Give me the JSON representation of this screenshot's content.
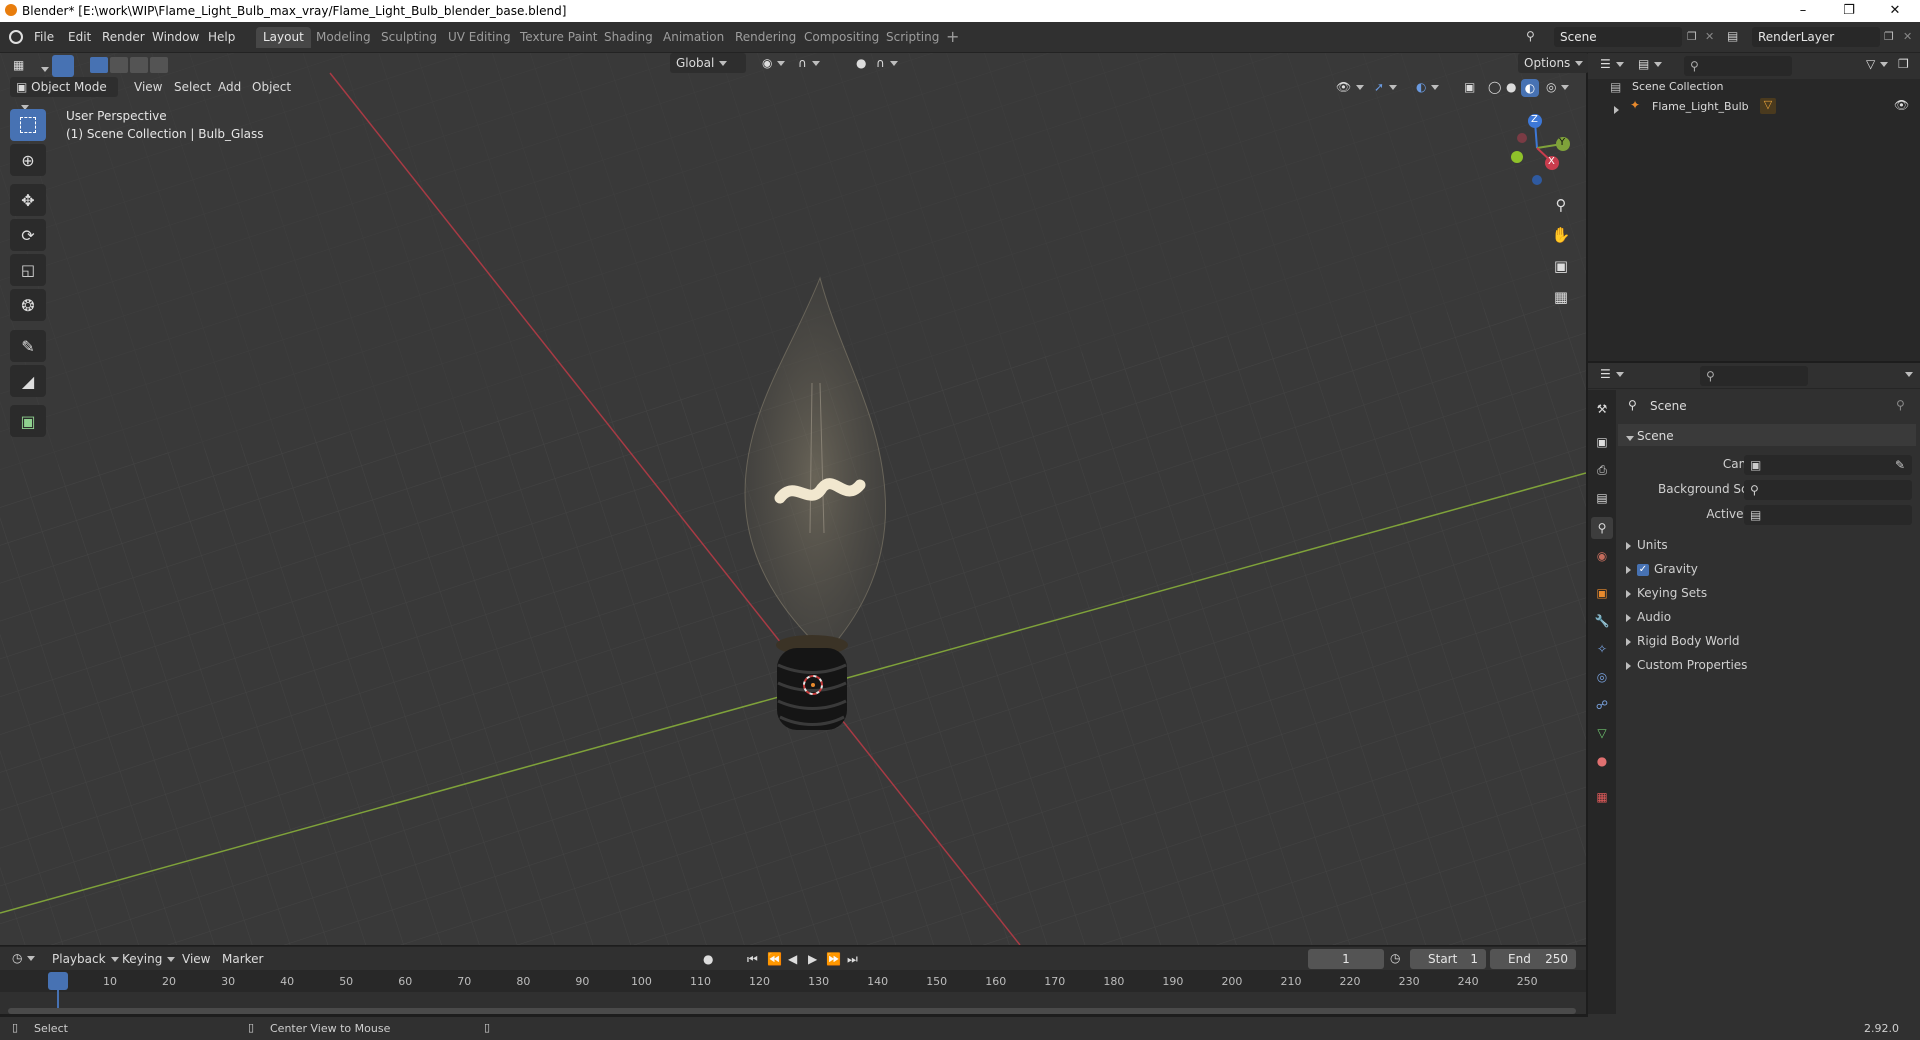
{
  "window": {
    "title": "Blender* [E:\\work\\WIP\\Flame_Light_Bulb_max_vray/Flame_Light_Bulb_blender_base.blend]"
  },
  "menu": [
    "File",
    "Edit",
    "Render",
    "Window",
    "Help"
  ],
  "workspaces": [
    "Layout",
    "Modeling",
    "Sculpting",
    "UV Editing",
    "Texture Paint",
    "Shading",
    "Animation",
    "Rendering",
    "Compositing",
    "Scripting"
  ],
  "scene": {
    "name": "Scene",
    "view_layer": "RenderLayer"
  },
  "viewport": {
    "mode": "Object Mode",
    "menus": [
      "View",
      "Select",
      "Add",
      "Object"
    ],
    "orientation": "Global",
    "options": "Options",
    "overlay_line1": "User Perspective",
    "overlay_line2": "(1) Scene Collection | Bulb_Glass",
    "axis_x": "X",
    "axis_y": "Y",
    "axis_z": "Z",
    "grid_x_color": "#a83a44",
    "grid_y_color": "#7fa23a"
  },
  "toolbar_icons": [
    "select-box-icon",
    "cursor-icon",
    "move-icon",
    "rotate-icon",
    "scale-icon",
    "transform-icon",
    "annotate-icon",
    "measure-icon",
    "add-cube-icon"
  ],
  "outliner": {
    "root": "Scene Collection",
    "item": "Flame_Light_Bulb"
  },
  "properties": {
    "context": "Scene",
    "panel": "Scene",
    "fields": [
      {
        "label": "Camera",
        "value": ""
      },
      {
        "label": "Background Scene",
        "value": ""
      },
      {
        "label": "Active Clip",
        "value": ""
      }
    ],
    "sections": [
      "Units",
      "Gravity",
      "Keying Sets",
      "Audio",
      "Rigid Body World",
      "Custom Properties"
    ],
    "gravity_checked": true
  },
  "timeline": {
    "menus": [
      "Playback",
      "Keying",
      "View",
      "Marker"
    ],
    "current_frame": "1",
    "start_label": "Start",
    "start": "1",
    "end_label": "End",
    "end": "250",
    "ticks": [
      "1",
      "10",
      "20",
      "30",
      "40",
      "50",
      "60",
      "70",
      "80",
      "90",
      "100",
      "110",
      "120",
      "130",
      "140",
      "150",
      "160",
      "170",
      "180",
      "190",
      "200",
      "210",
      "220",
      "230",
      "240",
      "250"
    ]
  },
  "status": {
    "left": "Select",
    "middle": "Center View to Mouse",
    "version": "2.92.0"
  },
  "accent": "#4772b3"
}
